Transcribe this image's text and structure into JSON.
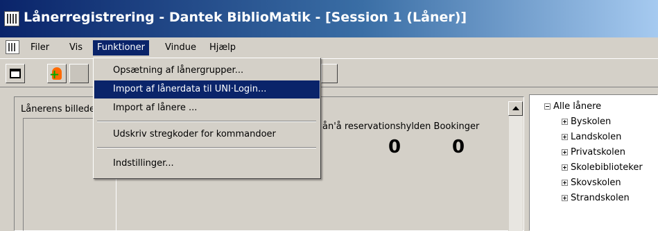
{
  "window": {
    "title": "Lånerregistrering - Dantek BiblioMatik - [Session 1 (Låner)]"
  },
  "menubar": {
    "items": [
      {
        "label": "Filer"
      },
      {
        "label": "Vis"
      },
      {
        "label": "Funktioner",
        "active": true
      },
      {
        "label": "Vindue"
      },
      {
        "label": "Hjælp"
      }
    ]
  },
  "dropdown": {
    "items": [
      {
        "label": "Opsætning af lånergrupper..."
      },
      {
        "label": "Import af lånerdata til UNI·Login...",
        "highlighted": true
      },
      {
        "label": "Import af lånere ..."
      },
      {
        "label": "Udskriv stregkoder for kommandoer"
      },
      {
        "label": "Indstillinger..."
      }
    ]
  },
  "main": {
    "photo_label": "Lånerens billede",
    "columns_text": "ån'å reservationshylden Bookinger",
    "counts": [
      "0",
      "0"
    ]
  },
  "tree": {
    "root": "Alle lånere",
    "children": [
      "Byskolen",
      "Landskolen",
      "Privatskolen",
      "Skolebiblioteker",
      "Skovskolen",
      "Strandskolen"
    ]
  },
  "colors": {
    "title_dark": "#0a246a",
    "title_light": "#a6caf0",
    "face": "#d4d0c8",
    "highlight": "#0a246a"
  }
}
